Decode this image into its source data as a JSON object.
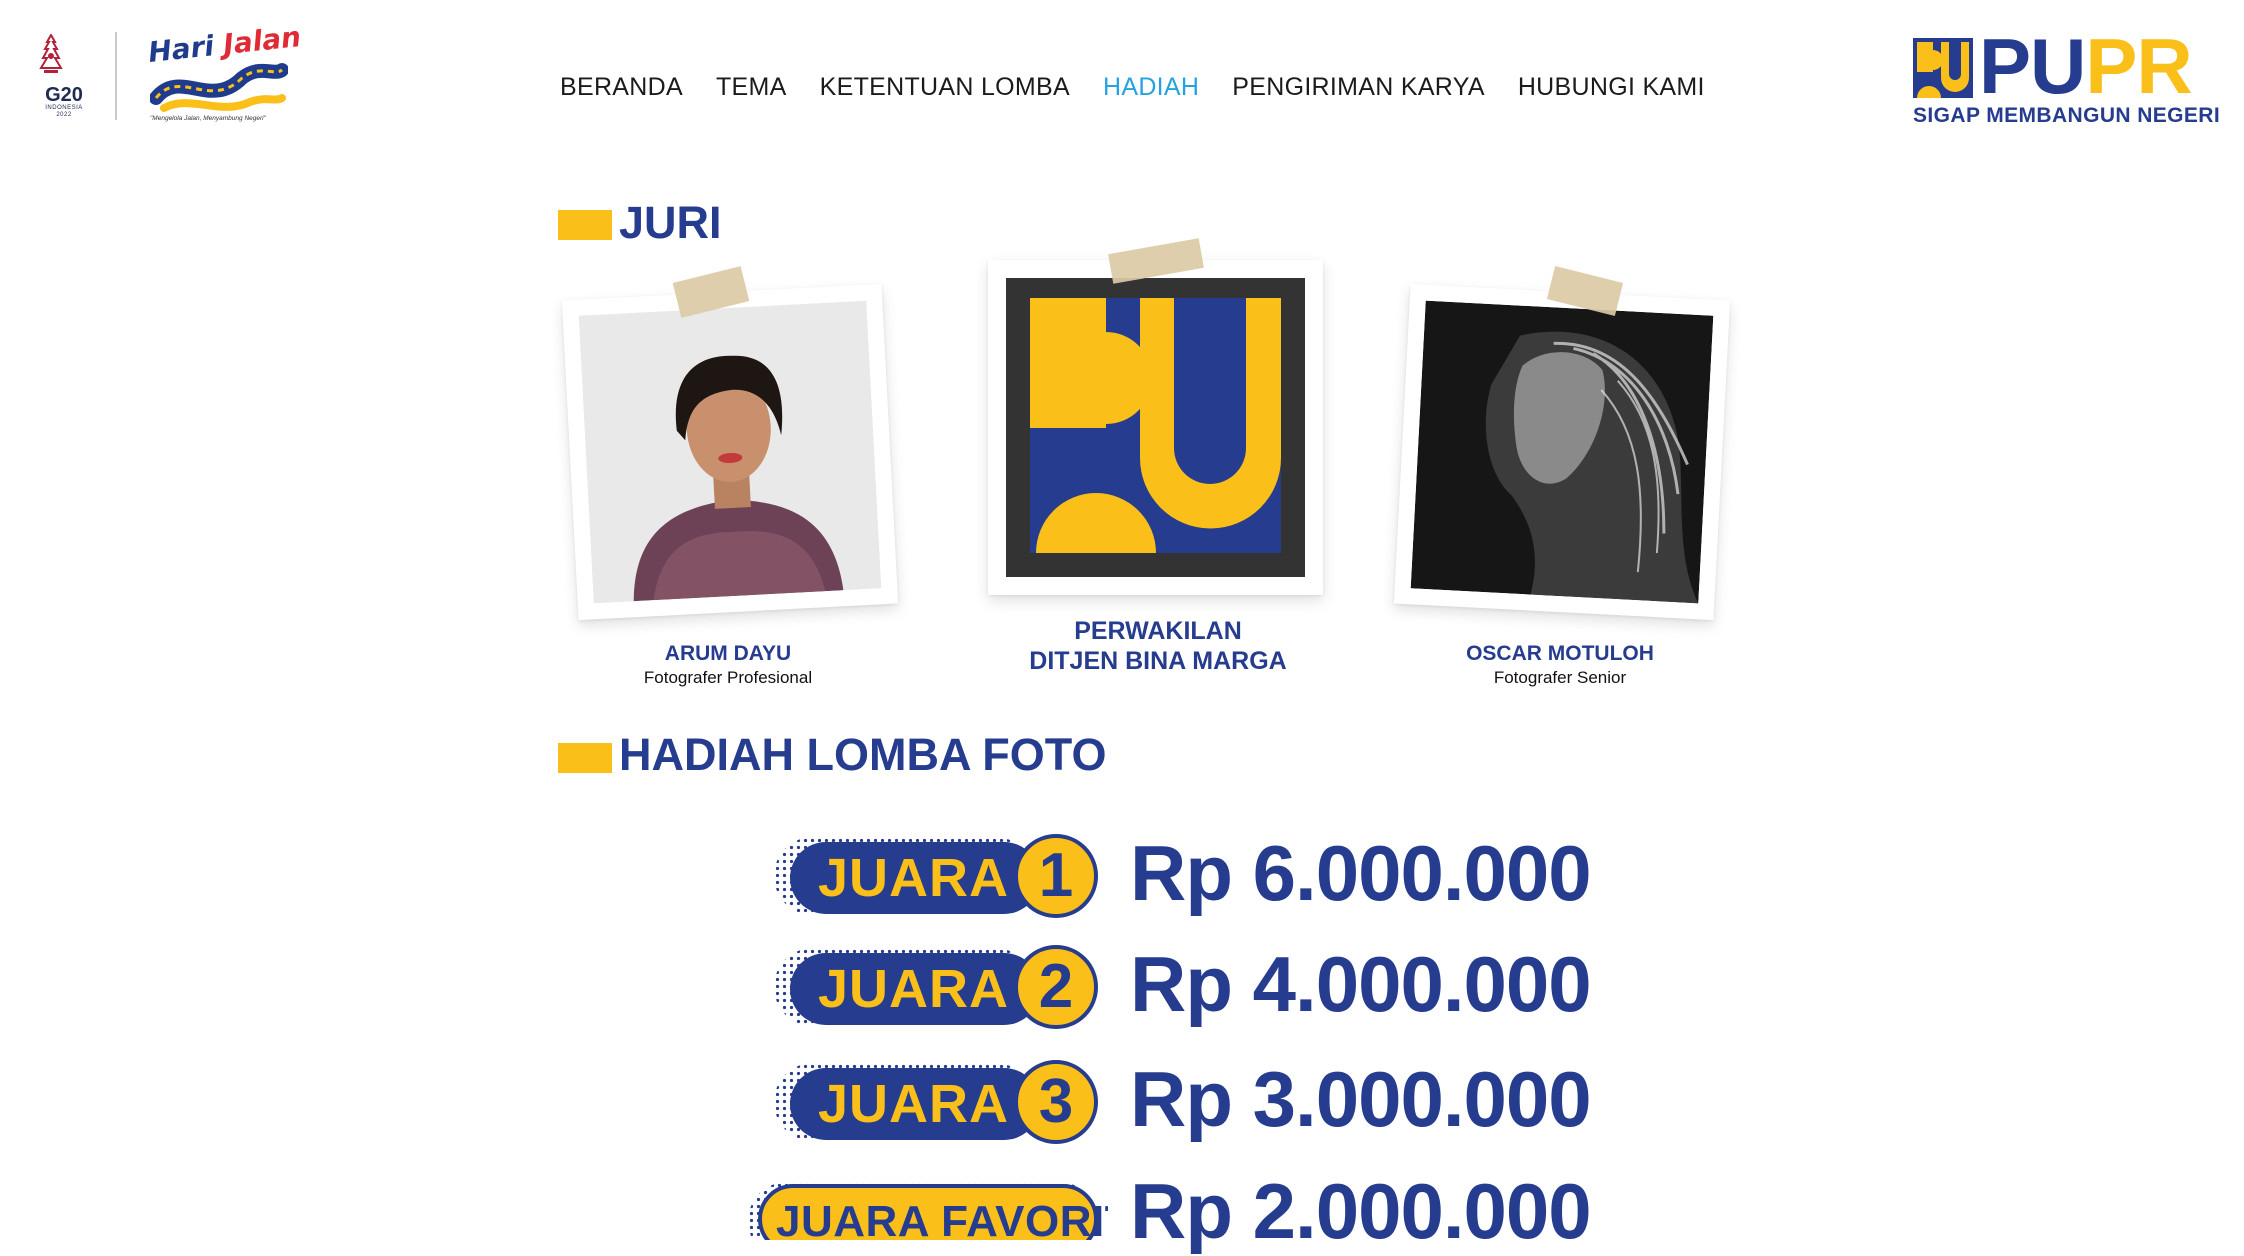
{
  "header": {
    "g20": {
      "label": "G20",
      "sub_1": "INDONESIA",
      "sub_2": "2022"
    },
    "hari_jalan": {
      "word_1": "Hari",
      "word_2": "Jalan",
      "tagline": "\"Mengelola Jalan, Menyambung Negeri\""
    },
    "nav": [
      {
        "label": "BERANDA",
        "active": false
      },
      {
        "label": "TEMA",
        "active": false
      },
      {
        "label": "KETENTUAN LOMBA",
        "active": false
      },
      {
        "label": "HADIAH",
        "active": true
      },
      {
        "label": "PENGIRIMAN KARYA",
        "active": false
      },
      {
        "label": "HUBUNGI KAMI",
        "active": false
      }
    ],
    "pupr": {
      "word_pu": "PU",
      "word_pr": "PR",
      "tagline": "SIGAP MEMBANGUN NEGERI"
    }
  },
  "juri": {
    "title": "JURI",
    "members": [
      {
        "name": "ARUM DAYU",
        "role": "Fotografer Profesional",
        "photo_icon": "portrait-photo"
      },
      {
        "name_line_1": "PERWAKILAN",
        "name_line_2": "DITJEN BINA MARGA",
        "photo_icon": "pu-logo"
      },
      {
        "name": "OSCAR MOTULOH",
        "role": "Fotografer Senior",
        "photo_icon": "bw-portrait-photo"
      }
    ]
  },
  "hadiah": {
    "title": "HADIAH LOMBA FOTO",
    "prizes": [
      {
        "label": "JUARA",
        "rank": "1",
        "amount": "Rp 6.000.000"
      },
      {
        "label": "JUARA",
        "rank": "2",
        "amount": "Rp 4.000.000"
      },
      {
        "label": "JUARA",
        "rank": "3",
        "amount": "Rp 3.000.000"
      },
      {
        "label": "JUARA FAVORIT",
        "amount": "Rp 2.000.000"
      }
    ]
  },
  "colors": {
    "brand_blue": "#263c8e",
    "brand_yellow": "#fbbf19",
    "nav_active": "#25a3e0"
  }
}
